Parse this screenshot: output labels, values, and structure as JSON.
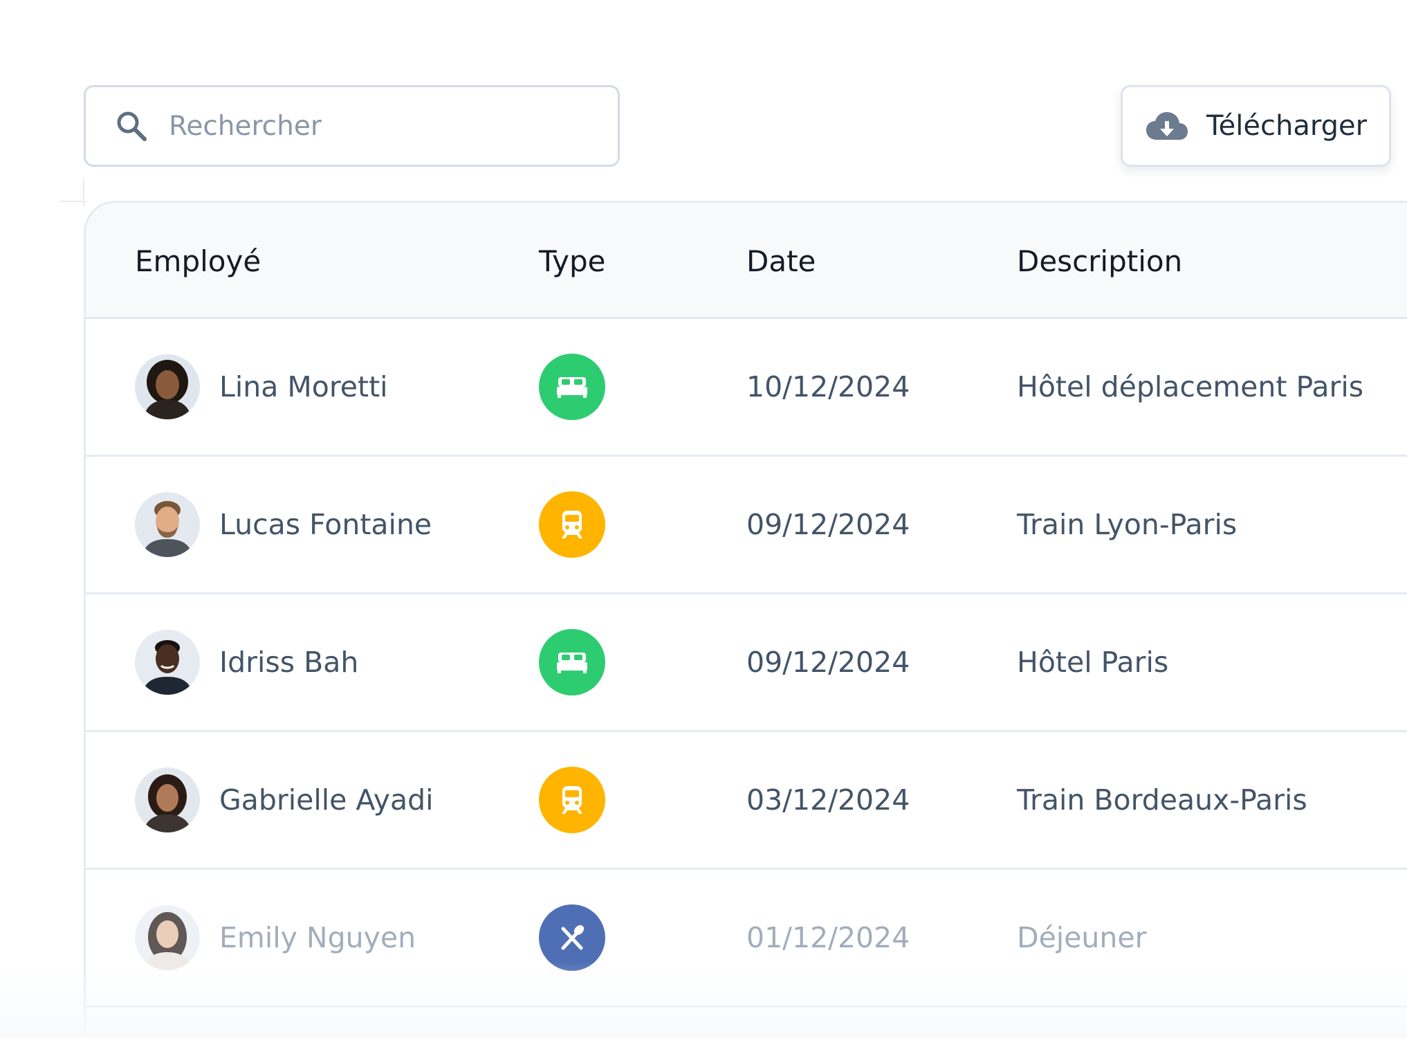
{
  "toolbar": {
    "search_placeholder": "Rechercher",
    "download_label": "Télécharger"
  },
  "table": {
    "columns": [
      "Employé",
      "Type",
      "Date",
      "Description"
    ],
    "rows": [
      {
        "employee": "Lina Moretti",
        "type": "hotel",
        "type_icon": "bed-icon",
        "type_color": "#2ecc71",
        "date": "10/12/2024",
        "description": "Hôtel déplacement Paris"
      },
      {
        "employee": "Lucas Fontaine",
        "type": "train",
        "type_icon": "train-icon",
        "type_color": "#ffb400",
        "date": "09/12/2024",
        "description": "Train Lyon-Paris"
      },
      {
        "employee": "Idriss Bah",
        "type": "hotel",
        "type_icon": "bed-icon",
        "type_color": "#2ecc71",
        "date": "09/12/2024",
        "description": "Hôtel Paris"
      },
      {
        "employee": "Gabrielle Ayadi",
        "type": "train",
        "type_icon": "train-icon",
        "type_color": "#ffb400",
        "date": "03/12/2024",
        "description": "Train Bordeaux-Paris"
      },
      {
        "employee": "Emily Nguyen",
        "type": "meal",
        "type_icon": "fork-knife-icon",
        "type_color": "#4f6fb5",
        "date": "01/12/2024",
        "description": "Déjeuner"
      }
    ]
  },
  "colors": {
    "hotel": "#2ecc71",
    "train": "#ffb400",
    "meal": "#4f6fb5",
    "border": "#d3dbe6",
    "header_bg": "#f8f9fb"
  }
}
